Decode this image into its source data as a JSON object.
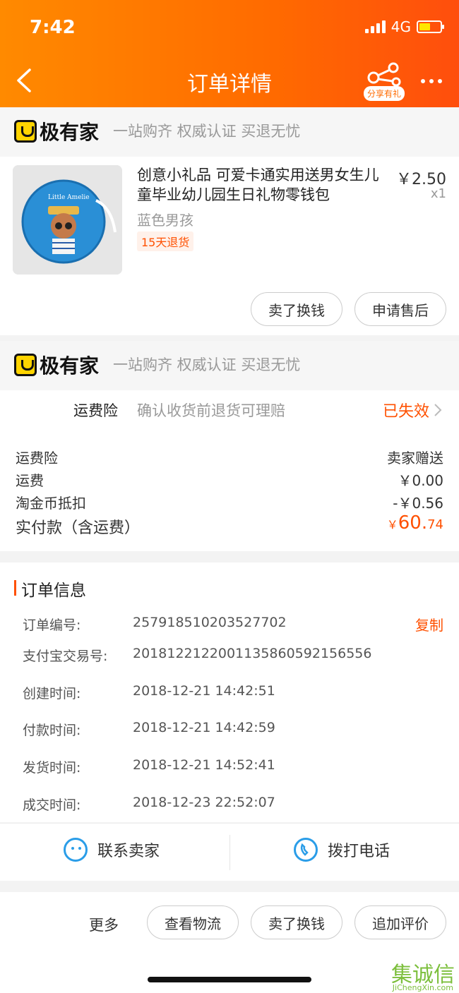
{
  "status_bar": {
    "time": "7:42",
    "network": "4G"
  },
  "header": {
    "title": "订单详情",
    "share_badge": "分享有礼"
  },
  "shop": {
    "name": "极有家",
    "slogan": "一站购齐 权威认证 买退无忧"
  },
  "product": {
    "title": "创意小礼品 可爱卡通实用送男女生儿童毕业幼儿园生日礼物零钱包",
    "price": "￥2.50",
    "qty": "x1",
    "sku": "蓝色男孩",
    "return_tag": "15天退货",
    "image_text": "Little Amelie"
  },
  "item_actions": {
    "sell": "卖了换钱",
    "after_sale": "申请售后"
  },
  "shipping_insurance": {
    "label": "运费险",
    "desc": "确认收货前退货可理赔",
    "status": "已失效"
  },
  "costs": [
    {
      "label": "运费险",
      "value": "卖家赠送"
    },
    {
      "label": "运费",
      "value": "￥0.00"
    },
    {
      "label": "淘金币抵扣",
      "value": "-￥0.56"
    }
  ],
  "total": {
    "label": "实付款（含运费）",
    "currency": "￥",
    "int": "60.",
    "dec": "74"
  },
  "order_info": {
    "title": "订单信息",
    "copy": "复制",
    "rows": [
      {
        "label": "订单编号:",
        "value": "257918510203527702"
      },
      {
        "label": "支付宝交易号:",
        "value": "2018122122001135860592156556"
      },
      {
        "label": "创建时间:",
        "value": "2018-12-21 14:42:51"
      },
      {
        "label": "付款时间:",
        "value": "2018-12-21 14:42:59"
      },
      {
        "label": "发货时间:",
        "value": "2018-12-21 14:52:41"
      },
      {
        "label": "成交时间:",
        "value": "2018-12-23 22:52:07"
      }
    ]
  },
  "contact": {
    "seller": "联系卖家",
    "call": "拨打电话"
  },
  "bottom": {
    "more": "更多",
    "logistics": "查看物流",
    "sell": "卖了换钱",
    "review": "追加评价"
  },
  "watermark": {
    "main": "集诚信",
    "sub": "JiChengXin.com"
  },
  "colors": {
    "accent": "#ff5000",
    "header": "#ff7a00",
    "contact_icon": "#2a9de8"
  }
}
